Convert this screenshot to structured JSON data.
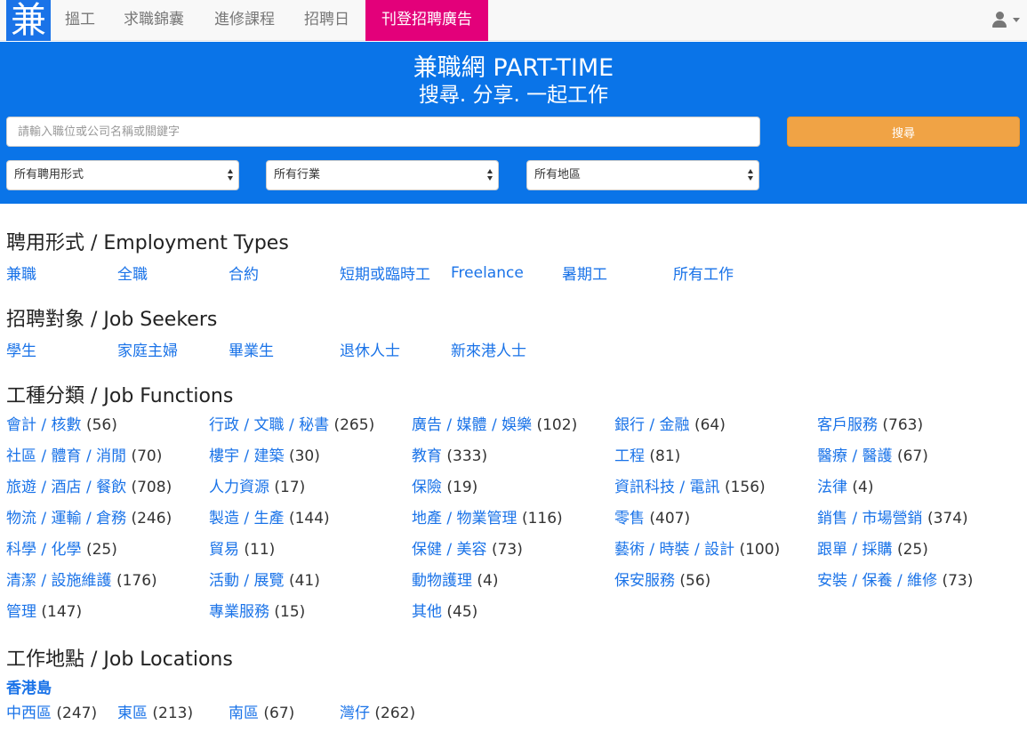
{
  "nav": {
    "logo": "兼",
    "items": [
      "搵工",
      "求職錦囊",
      "進修課程",
      "招聘日"
    ],
    "cta": "刊登招聘廣告"
  },
  "hero": {
    "title": "兼職網 PART-TIME",
    "subtitle": "搜尋. 分享. 一起工作",
    "search_placeholder": "請輸入職位或公司名稱或關鍵字",
    "search_button": "搜尋",
    "selects": [
      "所有聘用形式",
      "所有行業",
      "所有地區"
    ]
  },
  "employment": {
    "title": "聘用形式 / Employment Types",
    "links": [
      "兼職",
      "全職",
      "合約",
      "短期或臨時工",
      "Freelance",
      "暑期工",
      "所有工作"
    ]
  },
  "seekers": {
    "title": "招聘對象 / Job Seekers",
    "links": [
      "學生",
      "家庭主婦",
      "畢業生",
      "退休人士",
      "新來港人士"
    ]
  },
  "functions": {
    "title": "工種分類 / Job Functions",
    "items": [
      {
        "name": "會計 / 核數",
        "count": "(56)"
      },
      {
        "name": "行政 / 文職 / 秘書",
        "count": "(265)"
      },
      {
        "name": "廣告 / 媒體 / 娛樂",
        "count": "(102)"
      },
      {
        "name": "銀行 / 金融",
        "count": "(64)"
      },
      {
        "name": "客戶服務",
        "count": "(763)"
      },
      {
        "name": "社區 / 體育 / 消閒",
        "count": "(70)"
      },
      {
        "name": "樓宇 / 建築",
        "count": "(30)"
      },
      {
        "name": "教育",
        "count": "(333)"
      },
      {
        "name": "工程",
        "count": "(81)"
      },
      {
        "name": "醫療 / 醫護",
        "count": "(67)"
      },
      {
        "name": "旅遊 / 酒店 / 餐飲",
        "count": "(708)"
      },
      {
        "name": "人力資源",
        "count": "(17)"
      },
      {
        "name": "保險",
        "count": "(19)"
      },
      {
        "name": "資訊科技 / 電訊",
        "count": "(156)"
      },
      {
        "name": "法律",
        "count": "(4)"
      },
      {
        "name": "物流 / 運輸 / 倉務",
        "count": "(246)"
      },
      {
        "name": "製造 / 生產",
        "count": "(144)"
      },
      {
        "name": "地產 / 物業管理",
        "count": "(116)"
      },
      {
        "name": "零售",
        "count": "(407)"
      },
      {
        "name": "銷售 / 市場營銷",
        "count": "(374)"
      },
      {
        "name": "科學 / 化學",
        "count": "(25)"
      },
      {
        "name": "貿易",
        "count": "(11)"
      },
      {
        "name": "保健 / 美容",
        "count": "(73)"
      },
      {
        "name": "藝術 / 時裝 / 設計",
        "count": "(100)"
      },
      {
        "name": "跟單 / 採購",
        "count": "(25)"
      },
      {
        "name": "清潔 / 設施維護",
        "count": "(176)"
      },
      {
        "name": "活動 / 展覽",
        "count": "(41)"
      },
      {
        "name": "動物護理",
        "count": "(4)"
      },
      {
        "name": "保安服務",
        "count": "(56)"
      },
      {
        "name": "安裝 / 保養 / 維修",
        "count": "(73)"
      },
      {
        "name": "管理",
        "count": "(147)"
      },
      {
        "name": "專業服務",
        "count": "(15)"
      },
      {
        "name": "其他",
        "count": "(45)"
      }
    ]
  },
  "locations": {
    "title": "工作地點 / Job Locations",
    "region": "香港島",
    "items": [
      {
        "name": "中西區",
        "count": "(247)"
      },
      {
        "name": "東區",
        "count": "(213)"
      },
      {
        "name": "南區",
        "count": "(67)"
      },
      {
        "name": "灣仔",
        "count": "(262)"
      }
    ]
  },
  "colors": {
    "brand_blue": "#0a74e8",
    "link_blue": "#1a73e8",
    "cta_pink": "#e3007a",
    "search_orange": "#f0a345"
  }
}
